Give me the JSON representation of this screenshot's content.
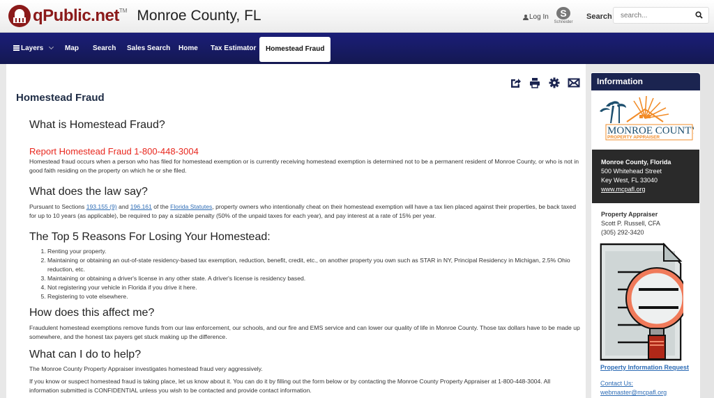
{
  "header": {
    "brand": "qPublic.net",
    "brand_tm": "TM",
    "county": "Monroe County, FL",
    "login_label": "Log In",
    "schneider_label": "Schneider",
    "search_label": "Search",
    "search_placeholder": "search..."
  },
  "nav": {
    "items": [
      {
        "label": "Layers",
        "active": false
      },
      {
        "label": "Map",
        "active": false
      },
      {
        "label": "Search",
        "active": false
      },
      {
        "label": "Sales Search",
        "active": false
      },
      {
        "label": "Home",
        "active": false
      },
      {
        "label": "Tax Estimator",
        "active": false
      },
      {
        "label": "Homestead Fraud",
        "active": true
      }
    ]
  },
  "page": {
    "title": "Homestead Fraud",
    "toolbar_icons": [
      "share-icon",
      "print-icon",
      "gear-icon",
      "mail-icon"
    ]
  },
  "content": {
    "h_what": "What is Homestead Fraud?",
    "report": "Report Homestead Fraud 1-800-448-3004",
    "what_text": "Homestead fraud occurs when a person who has filed for homestead exemption or is currently receiving homestead exemption is determined not to be a permanent resident of Monroe County, or who is not in good faith residing on the property on which he or she filed.",
    "h_law": "What does the law say?",
    "law_pre": "Pursuant to Sections ",
    "law_link1": "193.155 (9)",
    "law_and": " and ",
    "law_link2": "196.161",
    "law_of": " of the ",
    "law_link3": "Florida Statutes",
    "law_post": ", property owners who intentionally cheat on their homestead exemption will have a tax lien placed against their properties, be back taxed for up to 10 years (as applicable), be required to pay a sizable penalty (50% of the unpaid taxes for each year), and pay interest at a rate of 15% per year.",
    "h_top5": "The Top 5 Reasons For Losing Your Homestead:",
    "reasons": [
      "Renting your property.",
      "Maintaining or obtaining an out-of-state residency-based tax exemption, reduction, benefit, credit, etc., on another property you own such as STAR in NY, Principal Residency in Michigan, 2.5% Ohio reduction, etc.",
      "Maintaining or obtaining a driver's license in any other state. A driver's license is residency based.",
      "Not registering your vehicle in Florida if you drive it here.",
      "Registering to vote elsewhere."
    ],
    "h_affect": "How does this affect me?",
    "affect_text": "Fraudulent homestead exemptions remove funds from our law enforcement, our schools, and our fire and EMS service and can lower our quality of life in Monroe County. Those tax dollars have to be made up somewhere, and the honest tax payers get stuck making up the difference.",
    "h_help": "What can I do to help?",
    "help_text1": "The Monroe County Property Appraiser investigates homestead fraud very aggressively.",
    "help_text2": "If you know or suspect homestead fraud is taking place, let us know about it. You can do it by filling out the form below or by contacting the Monroe County Property Appraiser at 1-800-448-3004. All information submitted is CONFIDENTIAL unless you wish to be contacted and provide contact information."
  },
  "sidebar": {
    "heading": "Information",
    "logo_line1": "MONROE COUNTY",
    "logo_line2": "PROPERTY APPRAISER",
    "office_name": "Monroe County, Florida",
    "office_street": "500 Whitehead Street",
    "office_city": "Key West, FL 33040",
    "office_web": "www.mcpafl.org",
    "appraiser_title": "Property Appraiser",
    "appraiser_name": "Scott P. Russell, CFA",
    "appraiser_phone": "(305) 292-3420",
    "pir_link": "Property Information Request",
    "contact_label": "Contact Us:",
    "contact_email": "webmaster@mcpafl.org"
  },
  "colors": {
    "nav_bg": "#1b1e78",
    "sidebar_head": "#1b2450",
    "brand_red": "#8b1a1a",
    "report_red": "#e8261d",
    "link_blue": "#2d6cb5"
  }
}
